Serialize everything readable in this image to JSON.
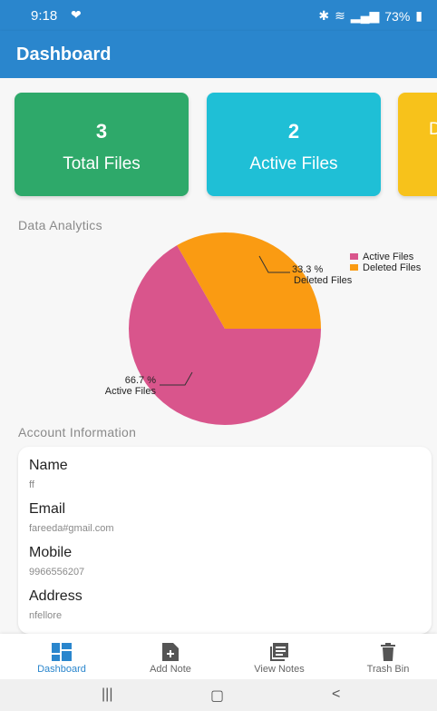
{
  "status_bar": {
    "time": "9:18",
    "battery": "73%"
  },
  "app_bar": {
    "title": "Dashboard"
  },
  "summary_cards": [
    {
      "number": "3",
      "label": "Total Files",
      "color": "#2ea96a"
    },
    {
      "number": "2",
      "label": "Active Files",
      "color": "#1fbfd6"
    },
    {
      "number": "",
      "label": "D",
      "color": "#f7c21b"
    }
  ],
  "analytics": {
    "section_label": "Data Analytics"
  },
  "chart_data": {
    "type": "pie",
    "slices": [
      {
        "name": "Active Files",
        "value": 66.7,
        "label": "66.7 %",
        "color": "#d9558c"
      },
      {
        "name": "Deleted Files",
        "value": 33.3,
        "label": "33.3 %",
        "color": "#fa9b12"
      }
    ],
    "legend_position": "top-right"
  },
  "account": {
    "section_label": "Account Information",
    "fields": [
      {
        "label": "Name",
        "value": "ff"
      },
      {
        "label": "Email",
        "value": "fareeda#gmail.com"
      },
      {
        "label": "Mobile",
        "value": "9966556207"
      },
      {
        "label": "Address",
        "value": "nfellore"
      }
    ]
  },
  "bottom_nav": [
    {
      "label": "Dashboard",
      "active": true
    },
    {
      "label": "Add Note",
      "active": false
    },
    {
      "label": "View Notes",
      "active": false
    },
    {
      "label": "Trash Bin",
      "active": false
    }
  ]
}
